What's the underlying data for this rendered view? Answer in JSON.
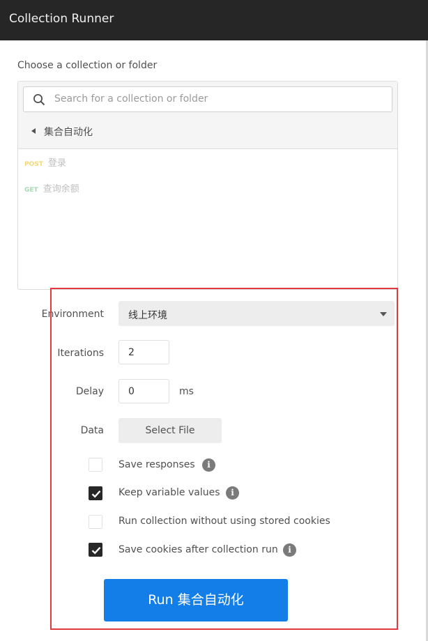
{
  "window": {
    "title": "Collection Runner"
  },
  "chooser": {
    "label": "Choose a collection or folder",
    "search_placeholder": "Search for a collection or folder",
    "breadcrumb": "集合自动化",
    "requests": [
      {
        "method": "POST",
        "name": "登录"
      },
      {
        "method": "GET",
        "name": "查询余额"
      }
    ]
  },
  "settings": {
    "environment_label": "Environment",
    "environment_value": "线上环境",
    "iterations_label": "Iterations",
    "iterations_value": "2",
    "delay_label": "Delay",
    "delay_value": "0",
    "delay_unit": "ms",
    "data_label": "Data",
    "select_file_label": "Select File"
  },
  "options": [
    {
      "label": "Save responses",
      "checked": false,
      "info": true
    },
    {
      "label": "Keep variable values",
      "checked": true,
      "info": true
    },
    {
      "label": "Run collection without using stored cookies",
      "checked": false,
      "info": false
    },
    {
      "label": "Save cookies after collection run",
      "checked": true,
      "info": true
    }
  ],
  "run_button_label": "Run 集合自动化",
  "colors": {
    "accent": "#137ee8",
    "annotation": "#e0393e",
    "title_bar": "#262626"
  }
}
